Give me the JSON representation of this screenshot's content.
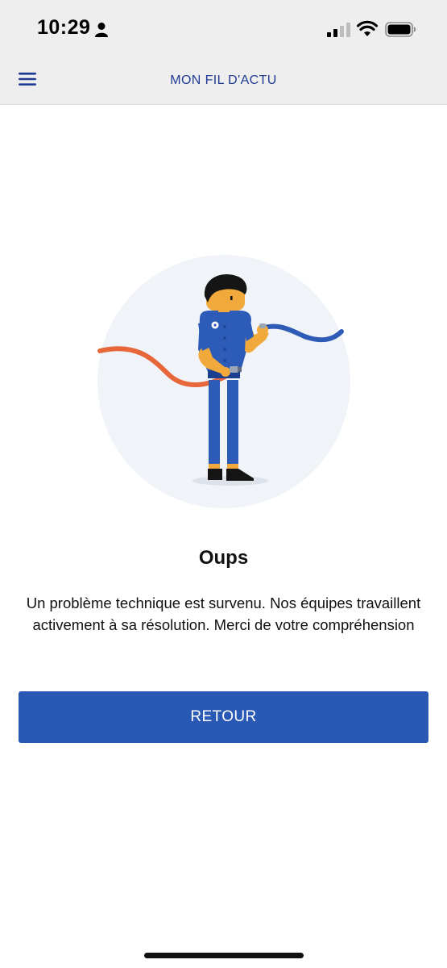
{
  "status_bar": {
    "time": "10:29"
  },
  "nav": {
    "title": "MON FIL D'ACTU",
    "menu_icon": "hamburger-menu-icon"
  },
  "error": {
    "title": "Oups",
    "message": "Un problème technique est survenu. Nos équipes travaillent activement à sa résolution. Merci de votre compréhension",
    "illustration": "worker-holding-broken-cable"
  },
  "actions": {
    "back_label": "RETOUR"
  },
  "colors": {
    "brand_blue": "#2a59b5",
    "nav_title": "#1f3a93",
    "cable_orange": "#e8673a",
    "cable_blue": "#2e5bb5"
  }
}
